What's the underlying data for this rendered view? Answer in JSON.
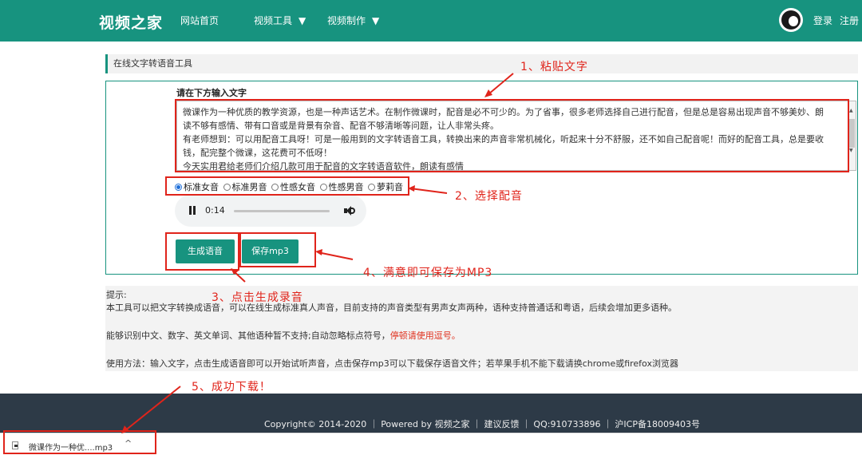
{
  "header": {
    "logo": "视频之家",
    "nav": [
      {
        "label": "网站首页"
      },
      {
        "label": "视频工具",
        "caret": "▼"
      },
      {
        "label": "视频制作",
        "caret": "▼"
      }
    ],
    "login": "登录",
    "register": "注册"
  },
  "tool": {
    "section_title": "在线文字转语音工具",
    "input_label": "请在下方输入文字",
    "text_lines": [
      "微课作为一种优质的教学资源，也是一种声话艺术。在制作微课时，配音是必不可少的。为了省事，很多老师选择自己进行配音，但是总是容易出现声音不够美妙、朗",
      "读不够有感情、带有口音或是背景有杂音、配音不够清晰等问题，让人非常头疼。",
      "有老师想到：可以用配音工具呀！可是一般用到的文字转语音工具，转换出来的声音非常机械化，听起来十分不舒服，还不如自己配音呢！而好的配音工具，总是要收",
      "钱，配完整个微课，这花费可不低呀！",
      "今天实用君给老师们介绍几款可用于配音的文字转语音软件，朗读有感情"
    ],
    "voices": [
      "标准女音",
      "标准男音",
      "性感女音",
      "性感男音",
      "萝莉音"
    ],
    "selected_voice": "标准女音",
    "player": {
      "time": "0:14",
      "progress": 0.0
    },
    "generate_button": "生成语音",
    "save_button": "保存mp3"
  },
  "tips": {
    "heading": "提示:",
    "line1": "本工具可以把文字转换成语音，可以在线生成标准真人声音，目前支持的声音类型有男声女声两种，语种支持普通话和粤语，后续会增加更多语种。",
    "line2_text": "能够识别中文、数字、英文单词、其他语种暂不支持;自动忽略标点符号，",
    "line2_warning": "停顿请使用逗号。",
    "line3": "使用方法：输入文字，点击生成语音即可以开始试听声音，点击保存mp3可以下载保存语音文件；若苹果手机不能下载请换chrome或firefox浏览器"
  },
  "footer": {
    "copyright": "Copyright© 2014-2020 ｜ Powered by 视频之家 ｜ 建议反馈 ｜ QQ:910733896 ｜ 沪ICP备18009403号"
  },
  "download": {
    "filename": "微课作为一种优....mp3",
    "caret": "^"
  },
  "annotations": {
    "step1": "1、粘贴文字",
    "step2": "2、选择配音",
    "step3": "3、点击生成录音",
    "step4": "4、满意即可保存为MP3",
    "step5": "5、成功下载！"
  },
  "colors": {
    "brand": "#17937f",
    "annotation": "#e0241b",
    "footer": "#2d3a47"
  }
}
